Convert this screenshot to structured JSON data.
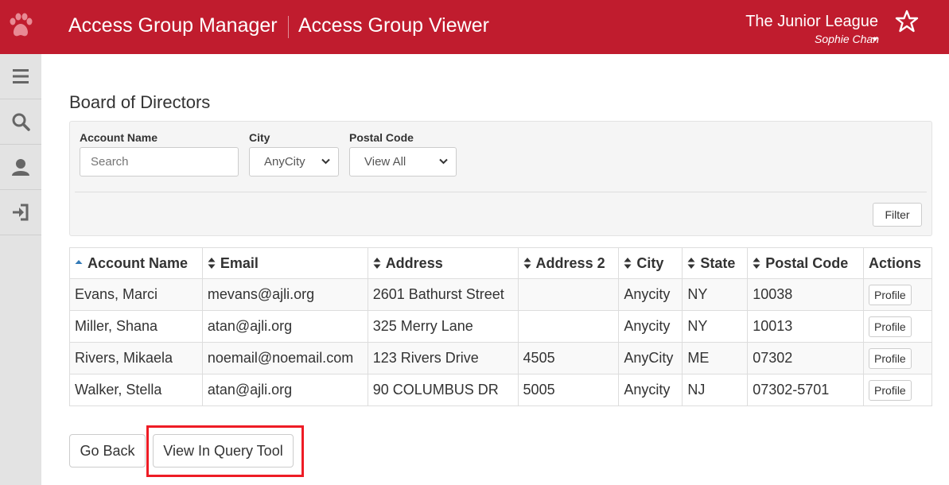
{
  "header": {
    "app_title": "Access Group Manager",
    "app_subtitle": "Access Group Viewer",
    "org_name": "The Junior League",
    "user_name": "Sophie Chan",
    "brand_color": "#c01c2e"
  },
  "sidebar": {
    "items": [
      {
        "icon": "menu-icon"
      },
      {
        "icon": "search-icon"
      },
      {
        "icon": "user-icon"
      },
      {
        "icon": "logout-icon"
      }
    ]
  },
  "page": {
    "title": "Board of Directors"
  },
  "filters": {
    "account_name_label": "Account Name",
    "account_name_placeholder": "Search",
    "city_label": "City",
    "city_value": "AnyCity",
    "postal_label": "Postal Code",
    "postal_value": "View All",
    "filter_button": "Filter"
  },
  "table": {
    "columns": [
      "Account Name",
      "Email",
      "Address",
      "Address 2",
      "City",
      "State",
      "Postal Code",
      "Actions"
    ],
    "sorted_column": "Account Name",
    "rows": [
      {
        "name": "Evans, Marci",
        "email": "mevans@ajli.org",
        "address": "2601 Bathurst Street",
        "address2": "",
        "city": "Anycity",
        "state": "NY",
        "postal": "10038",
        "action": "Profile"
      },
      {
        "name": "Miller, Shana",
        "email": "atan@ajli.org",
        "address": "325 Merry Lane",
        "address2": "",
        "city": "Anycity",
        "state": "NY",
        "postal": "10013",
        "action": "Profile"
      },
      {
        "name": "Rivers, Mikaela",
        "email": "noemail@noemail.com",
        "address": "123 Rivers Drive",
        "address2": "4505",
        "city": "AnyCity",
        "state": "ME",
        "postal": "07302",
        "action": "Profile"
      },
      {
        "name": "Walker, Stella",
        "email": "atan@ajli.org",
        "address": "90 COLUMBUS DR",
        "address2": "5005",
        "city": "Anycity",
        "state": "NJ",
        "postal": "07302-5701",
        "action": "Profile"
      }
    ]
  },
  "footer": {
    "go_back": "Go Back",
    "query_tool": "View In Query Tool",
    "highlight_color": "#ee1c25"
  }
}
